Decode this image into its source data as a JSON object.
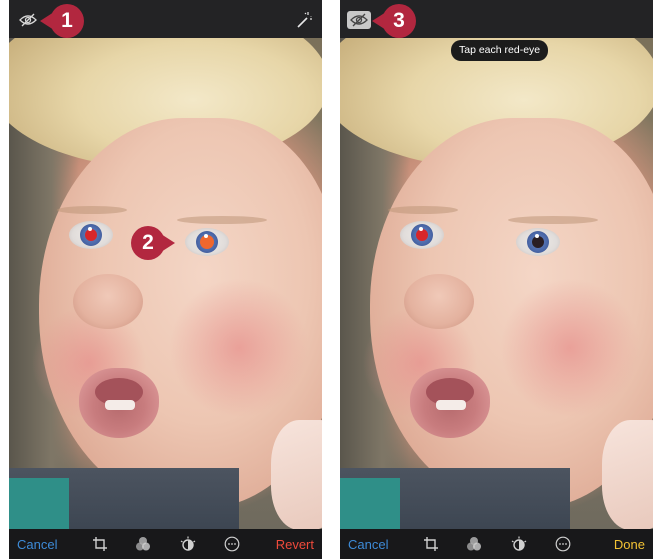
{
  "left_screen": {
    "cancel_label": "Cancel",
    "revert_label": "Revert"
  },
  "right_screen": {
    "cancel_label": "Cancel",
    "done_label": "Done",
    "tooltip": "Tap each red-eye"
  },
  "callouts": [
    "1",
    "2",
    "3"
  ],
  "icons": {
    "redeye_toggle": "eye-slash-icon",
    "auto_enhance": "magic-wand-icon",
    "crop": "crop-rotate-icon",
    "filters": "filters-icon",
    "adjust": "adjust-dial-icon",
    "more": "more-icon"
  },
  "colors": {
    "cancel": "#3d8bd8",
    "revert": "#ef4a3b",
    "done": "#f2c234",
    "callout": "#b2273f"
  }
}
